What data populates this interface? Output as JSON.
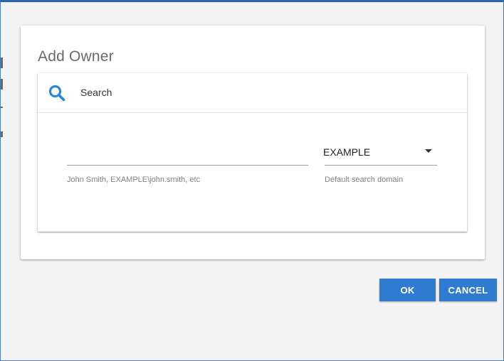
{
  "dialog": {
    "title": "Add Owner"
  },
  "search": {
    "icon": "search-icon",
    "label": "Search"
  },
  "owner_input": {
    "value": "",
    "hint": "John Smith, EXAMPLE\\john.smith, etc"
  },
  "domain_select": {
    "selected": "EXAMPLE",
    "hint": "Default search domain",
    "icon": "chevron-down-icon"
  },
  "buttons": {
    "ok_label": "OK",
    "cancel_label": "CANCEL"
  },
  "colors": {
    "accent": "#2f7bd0",
    "search_icon": "#2a86d8",
    "window_border": "#2b66b3"
  }
}
